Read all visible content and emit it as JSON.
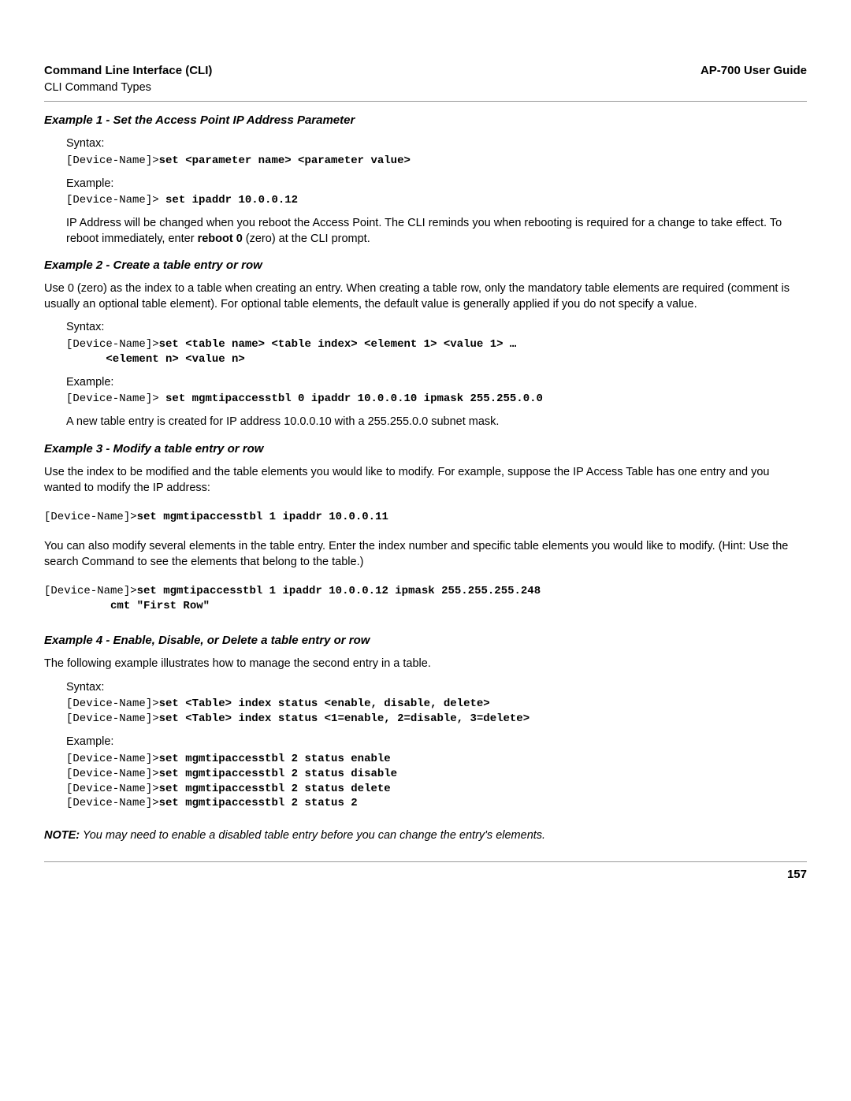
{
  "header": {
    "left_title": "Command Line Interface (CLI)",
    "left_sub": "CLI Command Types",
    "right": "AP-700 User Guide"
  },
  "ex1": {
    "title": "Example 1 - Set the Access Point IP Address Parameter",
    "syntax_label": "Syntax:",
    "syntax_prompt": "[Device-Name]>",
    "syntax_cmd": "set <parameter name> <parameter value>",
    "example_label": "Example:",
    "example_prompt": "[Device-Name]> ",
    "example_cmd": "set ipaddr 10.0.0.12",
    "body_1": "IP Address will be changed when you reboot the Access Point. The CLI reminds you when rebooting is required for a change to take effect. To reboot immediately, enter ",
    "body_bold": "reboot 0",
    "body_2": " (zero) at the CLI prompt."
  },
  "ex2": {
    "title": "Example 2 - Create a table entry or row",
    "intro": "Use 0 (zero) as the index to a table when creating an entry. When creating a table row, only the mandatory table elements are required (comment is usually an optional table element). For optional table elements, the default value is generally applied if you do not specify a value.",
    "syntax_label": "Syntax:",
    "syntax_prompt": "[Device-Name]>",
    "syntax_cmd_l1": "set <table name> <table index> <element 1> <value 1> …",
    "syntax_cmd_l2": "      <element n> <value n>",
    "example_label": "Example:",
    "example_prompt": "[Device-Name]> ",
    "example_cmd": "set mgmtipaccesstbl 0 ipaddr 10.0.0.10 ipmask 255.255.0.0",
    "body": "A new table entry is created for IP address 10.0.0.10 with a 255.255.0.0 subnet mask."
  },
  "ex3": {
    "title": "Example 3 - Modify a table entry or row",
    "intro": "Use the index to be modified and the table elements you would like to modify. For example, suppose the IP Access Table has one entry and you wanted to modify the IP address:",
    "cmd1_prompt": "[Device-Name]>",
    "cmd1_cmd": "set mgmtipaccesstbl 1 ipaddr 10.0.0.11",
    "mid": "You can also modify several elements in the table entry. Enter the index number and specific table elements you would like to modify. (Hint: Use the search Command to see the elements that belong to the table.)",
    "cmd2_prompt": "[Device-Name]>",
    "cmd2_l1": "set mgmtipaccesstbl 1 ipaddr 10.0.0.12 ipmask 255.255.255.248",
    "cmd2_l2": "          cmt \"First Row\""
  },
  "ex4": {
    "title": "Example 4 - Enable, Disable, or Delete a table entry or row",
    "intro": "The following example illustrates how to manage the second entry in a table.",
    "syntax_label": "Syntax:",
    "s_prompt": "[Device-Name]>",
    "s_l1": "set <Table> index status <enable, disable, delete>",
    "s_l2": "set <Table> index status <1=enable, 2=disable, 3=delete>",
    "example_label": "Example:",
    "e_prompt": "[Device-Name]>",
    "e_l1": "set mgmtipaccesstbl 2 status enable",
    "e_l2": "set mgmtipaccesstbl 2 status disable",
    "e_l3": "set mgmtipaccesstbl 2 status delete",
    "e_l4": "set mgmtipaccesstbl 2 status 2"
  },
  "note": {
    "label": "NOTE:",
    "body": " You may need to enable a disabled table entry before you can change the entry's elements."
  },
  "page_number": "157"
}
